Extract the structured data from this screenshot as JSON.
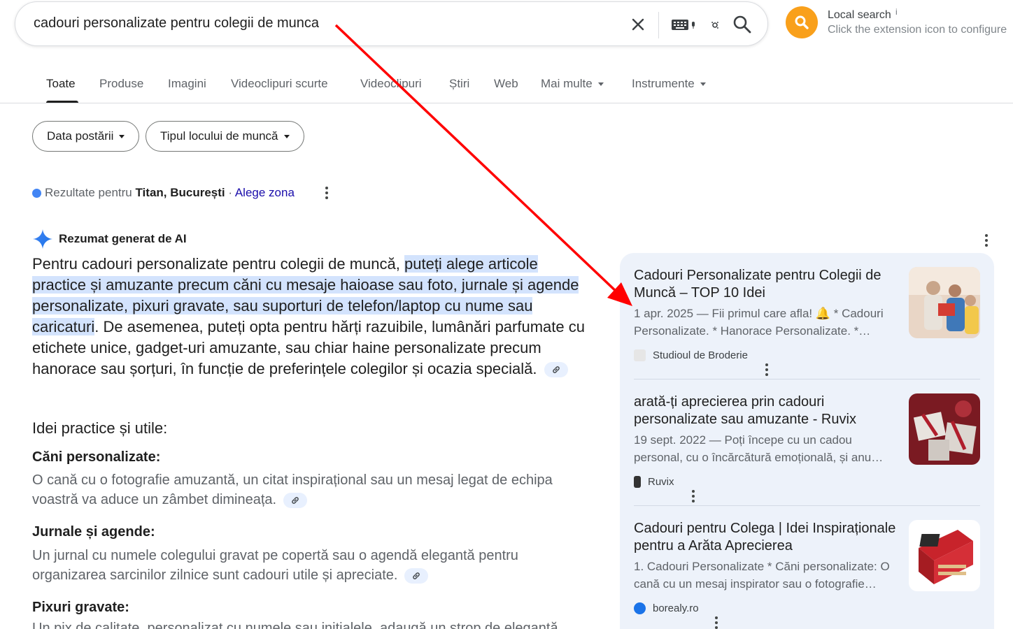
{
  "search": {
    "query": "cadouri personalizate pentru colegii de munca",
    "icons": [
      "close-icon",
      "keyboard-icon",
      "lens-icon",
      "search-icon"
    ]
  },
  "extension": {
    "title": "Local search",
    "info": "i",
    "subtitle": "Click the extension icon to configure",
    "color": "#f9a01b"
  },
  "tabs": [
    {
      "label": "Toate",
      "active": true
    },
    {
      "label": "Produse"
    },
    {
      "label": "Imagini"
    },
    {
      "label": "Videoclipuri scurte"
    },
    {
      "label": "Videoclipuri"
    },
    {
      "label": "Știri"
    },
    {
      "label": "Web"
    },
    {
      "label": "Mai multe"
    },
    {
      "label": "Instrumente"
    }
  ],
  "filters": [
    {
      "label": "Data postării"
    },
    {
      "label": "Tipul locului de muncă"
    }
  ],
  "location": {
    "prefix": "Rezultate pentru",
    "place": "Titan, București",
    "separator": "·",
    "change_label": "Alege zona"
  },
  "ai_overview": {
    "title": "Rezumat generat de AI",
    "intro_plain": "Pentru cadouri personalizate pentru colegii de muncă, ",
    "intro_highlight": "puteți alege articole practice și amuzante precum căni cu mesaje haioase sau foto, jurnale și agende personalizate, pixuri gravate, sau suporturi de telefon/laptop cu nume sau caricaturi",
    "intro_rest": ". De asemenea, puteți opta pentru hărți razuibile, lumânări parfumate cu etichete unice, gadget-uri amuzante, sau chiar haine personalizate precum hanorace sau șorțuri, în funcție de preferințele colegilor și ocazia specială.",
    "section_title": "Idei practice și utile:",
    "items": [
      {
        "title": "Căni personalizate:",
        "text": "O cană cu o fotografie amuzantă, un citat inspirațional sau un mesaj legat de echipa voastră va aduce un zâmbet dimineața."
      },
      {
        "title": "Jurnale și agende:",
        "text": "Un jurnal cu numele colegului gravat pe copertă sau o agendă elegantă pentru organizarea sarcinilor zilnice sunt cadouri utile și apreciate."
      },
      {
        "title": "Pixuri gravate:",
        "text": "Un pix de calitate, personalizat cu numele sau inițialele, adaugă un strop de eleganță"
      }
    ]
  },
  "sources": [
    {
      "title": "Cadouri Personalizate pentru Colegii de Muncă – TOP 10 Idei",
      "snippet": "1 apr. 2025 — Fii primul care afla! 🔔 * Cadouri Personalizate. * Hanorace Personalizate. *…",
      "site": "Studioul de Broderie"
    },
    {
      "title": "arată-ți aprecierea prin cadouri personalizate sau amuzante - Ruvix",
      "snippet": "19 sept. 2022 — Poți începe cu un cadou personal, cu o încărcătură emoțională, și anu…",
      "site": "Ruvix"
    },
    {
      "title": "Cadouri pentru Colega | Idei Inspiraționale pentru a Arăta Aprecierea",
      "snippet": "1. Cadouri Personalizate * Căni personalizate: O cană cu un mesaj inspirator sau o fotografie…",
      "site": "borealy.ro"
    }
  ],
  "colors": {
    "link": "#1a0dab",
    "highlight": "#d3e3fd",
    "panel": "#edf2fa",
    "annotation_arrow": "#ff0000"
  }
}
